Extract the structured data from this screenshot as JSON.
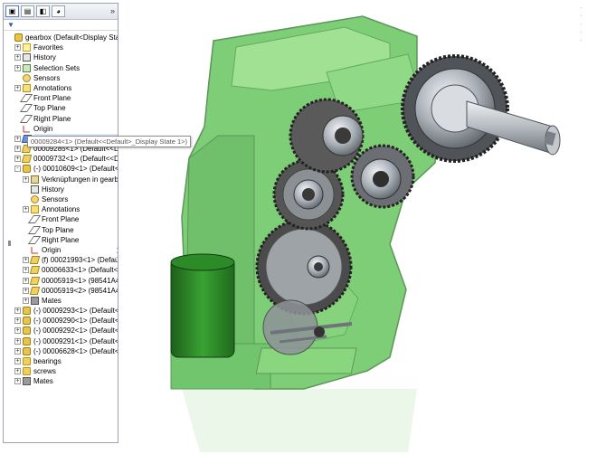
{
  "tabs": [
    {
      "name": "feature-manager-tab",
      "glyph": "▣",
      "active": true
    },
    {
      "name": "property-manager-tab",
      "glyph": "▤",
      "active": false
    },
    {
      "name": "configuration-manager-tab",
      "glyph": "◧",
      "active": false
    },
    {
      "name": "display-manager-tab",
      "glyph": "◕",
      "active": false
    }
  ],
  "tabbar_more": "»",
  "filter_glyph": "▼",
  "tree": [
    {
      "label": "gearbox  (Default<Display State-",
      "icon": "asm",
      "indent": 0,
      "exp": ""
    },
    {
      "label": "Favorites",
      "icon": "fav",
      "indent": 1,
      "exp": "+"
    },
    {
      "label": "History",
      "icon": "hist",
      "indent": 1,
      "exp": "+"
    },
    {
      "label": "Selection Sets",
      "icon": "sel",
      "indent": 1,
      "exp": "+"
    },
    {
      "label": "Sensors",
      "icon": "sensor",
      "indent": 1,
      "exp": ""
    },
    {
      "label": "Annotations",
      "icon": "annot",
      "indent": 1,
      "exp": "+"
    },
    {
      "label": "Front Plane",
      "icon": "plane",
      "indent": 1,
      "exp": ""
    },
    {
      "label": "Top Plane",
      "icon": "plane",
      "indent": 1,
      "exp": ""
    },
    {
      "label": "Right Plane",
      "icon": "plane",
      "indent": 1,
      "exp": ""
    },
    {
      "label": "Origin",
      "icon": "origin",
      "indent": 1,
      "exp": ""
    },
    {
      "label": "00009284<1> (Default<<Default>_Display State 1>)",
      "icon": "partblue",
      "indent": 1,
      "exp": "+",
      "selected": true
    },
    {
      "label": "00009285<1> (Default<<Defa",
      "icon": "part",
      "indent": 1,
      "exp": "+"
    },
    {
      "label": "00009732<1> (Default<<Defa",
      "icon": "part",
      "indent": 1,
      "exp": "+"
    },
    {
      "label": "(-) 00010609<1> (Default<Dis",
      "icon": "asm",
      "indent": 1,
      "exp": "-"
    },
    {
      "label": "Verknüpfungen in gearbo",
      "icon": "link",
      "indent": 2,
      "exp": "+"
    },
    {
      "label": "History",
      "icon": "hist",
      "indent": 2,
      "exp": ""
    },
    {
      "label": "Sensors",
      "icon": "sensor",
      "indent": 2,
      "exp": ""
    },
    {
      "label": "Annotations",
      "icon": "annot",
      "indent": 2,
      "exp": "+"
    },
    {
      "label": "Front Plane",
      "icon": "plane",
      "indent": 2,
      "exp": ""
    },
    {
      "label": "Top Plane",
      "icon": "plane",
      "indent": 2,
      "exp": ""
    },
    {
      "label": "Right Plane",
      "icon": "plane",
      "indent": 2,
      "exp": ""
    },
    {
      "label": "Origin",
      "icon": "origin",
      "indent": 2,
      "exp": ""
    },
    {
      "label": "(f) 00021993<1> (Default<",
      "icon": "part",
      "indent": 2,
      "exp": "+"
    },
    {
      "label": "00006633<1> (Default<<D",
      "icon": "part",
      "indent": 2,
      "exp": "+"
    },
    {
      "label": "00005919<1> (98541A410",
      "icon": "part",
      "indent": 2,
      "exp": "+"
    },
    {
      "label": "00005919<2> (98541A410",
      "icon": "part",
      "indent": 2,
      "exp": "+"
    },
    {
      "label": "Mates",
      "icon": "mates",
      "indent": 2,
      "exp": "+"
    },
    {
      "label": "(-) 00009293<1> (Default<Dis",
      "icon": "asm",
      "indent": 1,
      "exp": "+"
    },
    {
      "label": "(-) 00009290<1> (Default<Dis",
      "icon": "asm",
      "indent": 1,
      "exp": "+"
    },
    {
      "label": "(-) 00009292<1> (Default<Dis",
      "icon": "asm",
      "indent": 1,
      "exp": "+"
    },
    {
      "label": "(-) 00009291<1> (Default<Dis",
      "icon": "asm",
      "indent": 1,
      "exp": "+"
    },
    {
      "label": "(-) 00006628<1> (Default<<De",
      "icon": "asm",
      "indent": 1,
      "exp": "+"
    },
    {
      "label": "bearings",
      "icon": "folder",
      "indent": 1,
      "exp": "+"
    },
    {
      "label": "screws",
      "icon": "folder",
      "indent": 1,
      "exp": "+"
    },
    {
      "label": "Mates",
      "icon": "mates",
      "indent": 1,
      "exp": "+"
    }
  ],
  "tooltip": "00009284<1> (Default<<Default>_Display State 1>)",
  "toolbar_dots": "· · · · ·",
  "colors": {
    "housing_green": "#2e9e2a",
    "housing_light": "#7ed66b",
    "steel": "#9aa0a6",
    "dark_gear": "#4a4a4a"
  }
}
